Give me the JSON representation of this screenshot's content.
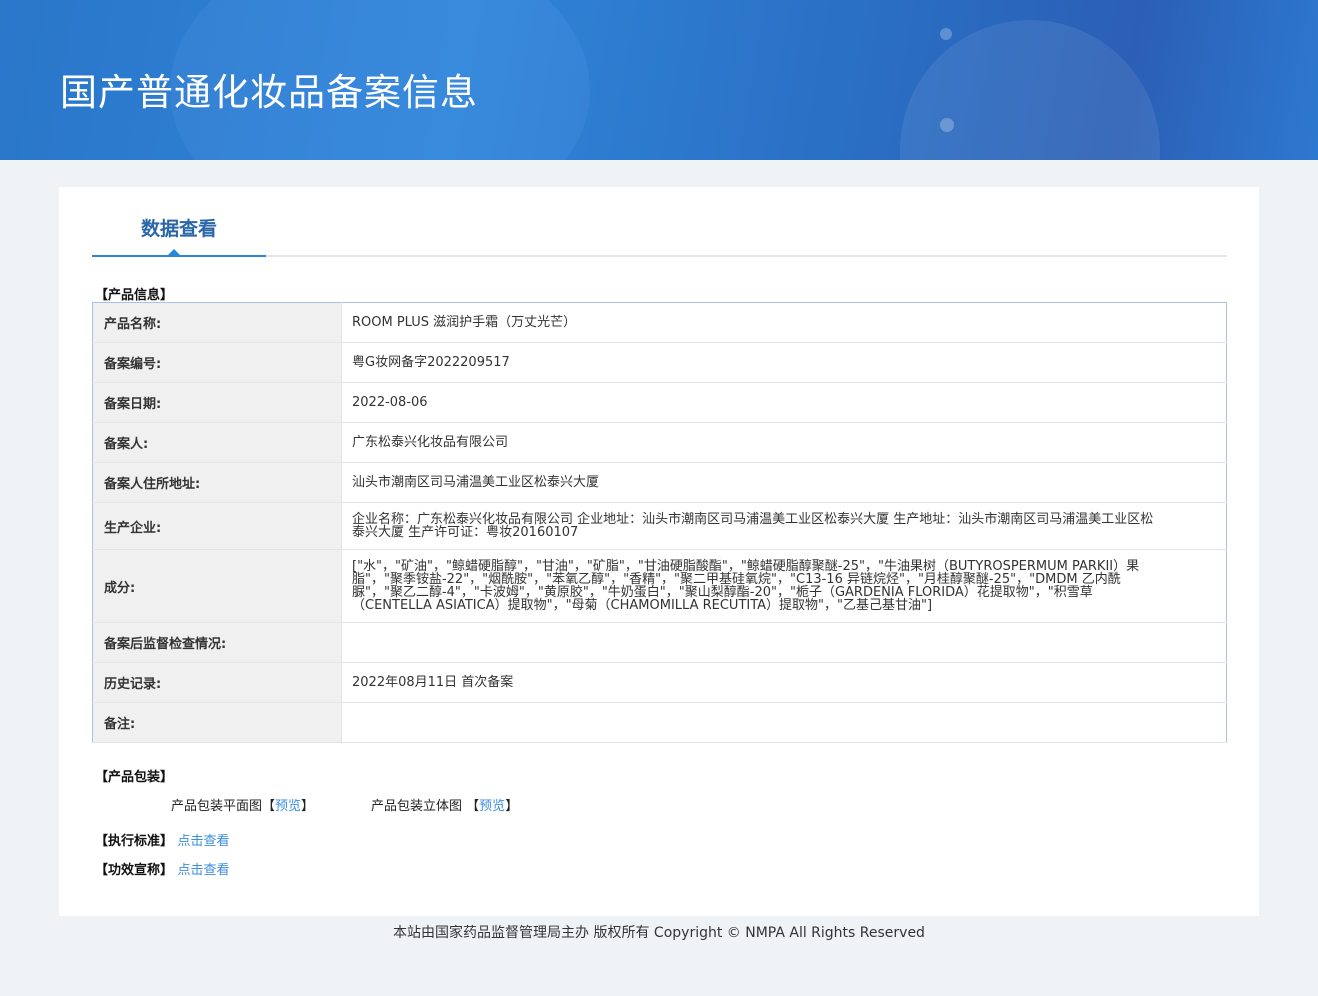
{
  "header": {
    "title": "国产普通化妆品备案信息"
  },
  "tab": {
    "label": "数据查看"
  },
  "product_info": {
    "section_title": "【产品信息】",
    "rows": [
      {
        "label": "产品名称:",
        "value": "ROOM PLUS 滋润护手霜（万丈光芒）"
      },
      {
        "label": "备案编号:",
        "value": "粤G妆网备字2022209517"
      },
      {
        "label": "备案日期:",
        "value": "2022-08-06"
      },
      {
        "label": "备案人:",
        "value": "广东松泰兴化妆品有限公司"
      },
      {
        "label": "备案人住所地址:",
        "value": "汕头市潮南区司马浦温美工业区松泰兴大厦"
      },
      {
        "label": "生产企业:",
        "value": "企业名称：广东松泰兴化妆品有限公司 企业地址：汕头市潮南区司马浦温美工业区松泰兴大厦 生产地址：汕头市潮南区司马浦温美工业区松泰兴大厦 生产许可证：粤妆20160107"
      },
      {
        "label": "成分:",
        "value": "[\"水\"，\"矿油\"，\"鲸蜡硬脂醇\"，\"甘油\"，\"矿脂\"，\"甘油硬脂酸酯\"，\"鲸蜡硬脂醇聚醚-25\"，\"牛油果树（BUTYROSPERMUM PARKII）果脂\"，\"聚季铵盐-22\"，\"烟酰胺\"，\"苯氧乙醇\"，\"香精\"，\"聚二甲基硅氧烷\"，\"C13-16 异链烷烃\"，\"月桂醇聚醚-25\"，\"DMDM 乙内酰脲\"，\"聚乙二醇-4\"，\"卡波姆\"，\"黄原胶\"，\"牛奶蛋白\"，\"聚山梨醇酯-20\"，\"栀子（GARDENIA FLORIDA）花提取物\"，\"积雪草（CENTELLA ASIATICA）提取物\"，\"母菊（CHAMOMILLA RECUTITA）提取物\"，\"乙基己基甘油\"]"
      },
      {
        "label": "备案后监督检查情况:",
        "value": ""
      },
      {
        "label": "历史记录:",
        "value": "2022年08月11日 首次备案"
      },
      {
        "label": "备注:",
        "value": ""
      }
    ]
  },
  "packaging": {
    "section_title": "【产品包装】",
    "flat_label": "产品包装平面图",
    "solid_label": "产品包装立体图",
    "open_bracket": "【",
    "close_bracket": "】",
    "preview": "预览"
  },
  "standard": {
    "section_title": "【执行标准】",
    "link": "点击查看"
  },
  "efficacy": {
    "section_title": "【功效宣称】",
    "link": "点击查看"
  },
  "footer": {
    "text": "本站由国家药品监督管理局主办 版权所有 Copyright © NMPA All Rights Reserved"
  }
}
